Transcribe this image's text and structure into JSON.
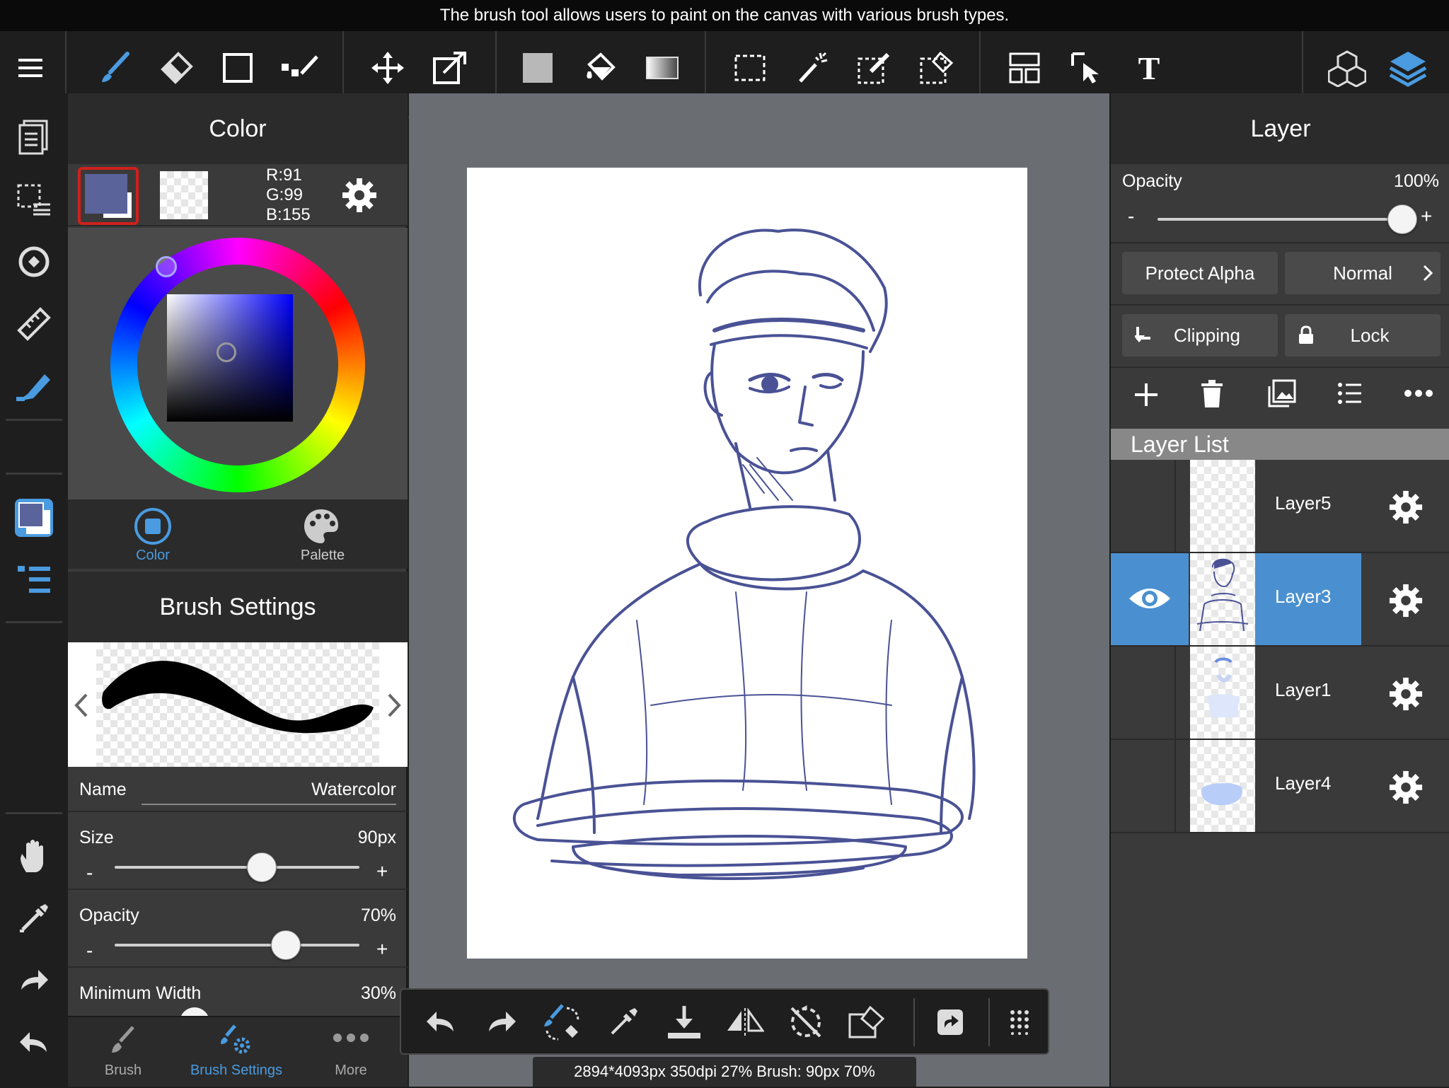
{
  "caption": "The brush tool allows users to paint on the canvas with various brush types.",
  "colors": {
    "accent": "#4a9be0",
    "selected_layer": "#4a90d0",
    "current_color": "#5b639b",
    "red_outline": "#d0201c"
  },
  "toolbar": {
    "icons": [
      "menu-icon",
      "brush-icon",
      "eraser-icon",
      "shape-icon",
      "dot-icon",
      "move-icon",
      "transform-icon",
      "fill-color-icon",
      "bucket-icon",
      "gradient-icon",
      "select-rect-icon",
      "magic-wand-icon",
      "select-pen-icon",
      "select-eraser-icon",
      "frame-divider-icon",
      "operation-icon",
      "text-icon",
      "3d-model-icon",
      "layers-icon"
    ],
    "text_label": "T"
  },
  "color_panel": {
    "title": "Color",
    "rgb": {
      "r": "R:91",
      "g": "G:99",
      "b": "B:155"
    },
    "tabs": [
      {
        "label": "Color",
        "active": true
      },
      {
        "label": "Palette",
        "active": false
      }
    ]
  },
  "brush_settings": {
    "title": "Brush Settings",
    "name_label": "Name",
    "name_value": "Watercolor",
    "size_label": "Size",
    "size_value": "90px",
    "size_fraction": 0.6,
    "opacity_label": "Opacity",
    "opacity_value": "70%",
    "opacity_fraction": 0.7,
    "min_width_label": "Minimum Width",
    "min_width_value": "30%",
    "minus": "-",
    "plus": "+"
  },
  "bottom_tabs": [
    {
      "label": "Brush",
      "active": false
    },
    {
      "label": "Brush Settings",
      "active": true
    },
    {
      "label": "More",
      "active": false
    }
  ],
  "layer_panel": {
    "title": "Layer",
    "opacity_label": "Opacity",
    "opacity_value": "100%",
    "opacity_fraction": 1.0,
    "minus": "-",
    "plus": "+",
    "protect_alpha": "Protect Alpha",
    "blend_mode": "Normal",
    "clipping": "Clipping",
    "lock": "Lock",
    "list_title": "Layer List",
    "layers": [
      {
        "name": "Layer5",
        "selected": false,
        "visible": false
      },
      {
        "name": "Layer3",
        "selected": true,
        "visible": true
      },
      {
        "name": "Layer1",
        "selected": false,
        "visible": false
      },
      {
        "name": "Layer4",
        "selected": false,
        "visible": false
      }
    ]
  },
  "status": "2894*4093px 350dpi 27% Brush: 90px 70%"
}
